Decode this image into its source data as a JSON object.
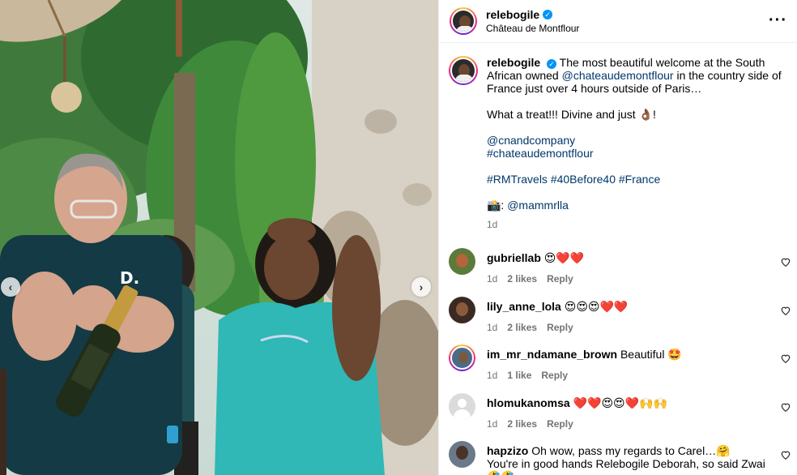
{
  "post": {
    "username": "relebogile",
    "location": "Château de Montflour",
    "more_icon": "more-horizontal-icon"
  },
  "caption": {
    "username": "relebogile",
    "line1_pre": "The most beautiful welcome at the South African owned ",
    "mention_chateau": "@chateaudemontflour",
    "line1_post": " in the country side of France just over 4 hours outside of Paris…",
    "line2": "What a treat!!! Divine and just 👌🏾!",
    "mention_company": "@cnandcompany",
    "hashtag_chateau": "#chateaudemontflour",
    "hashtags": "#RMTravels #40Before40 #France",
    "photo_credit_prefix": "📸: ",
    "photo_credit": "@mammrlla",
    "time": "1d"
  },
  "comments": [
    {
      "username": "gubriellab",
      "text": "😍❤️❤️",
      "time": "1d",
      "likes": "2 likes",
      "reply": "Reply"
    },
    {
      "username": "lily_anne_lola",
      "text": "😍😍😍❤️❤️",
      "time": "1d",
      "likes": "2 likes",
      "reply": "Reply"
    },
    {
      "username": "im_mr_ndamane_brown",
      "text": "Beautiful 🤩",
      "time": "1d",
      "likes": "1 like",
      "reply": "Reply"
    },
    {
      "username": "hlomukanomsa",
      "text": "❤️❤️😍😍❤️🙌🙌",
      "time": "1d",
      "likes": "2 likes",
      "reply": "Reply"
    },
    {
      "username": "hapzizo",
      "text": "Oh wow, pass my regards to Carel…🤗",
      "text2": "You're in good hands Relebogile Deborah, so said Zwai 🤣🤣"
    }
  ],
  "colors": {
    "link": "#00376b",
    "muted": "#737373",
    "verified": "#0095f6",
    "shirt_teal": "#2fb8b5",
    "shirt_navy": "#143a45"
  }
}
